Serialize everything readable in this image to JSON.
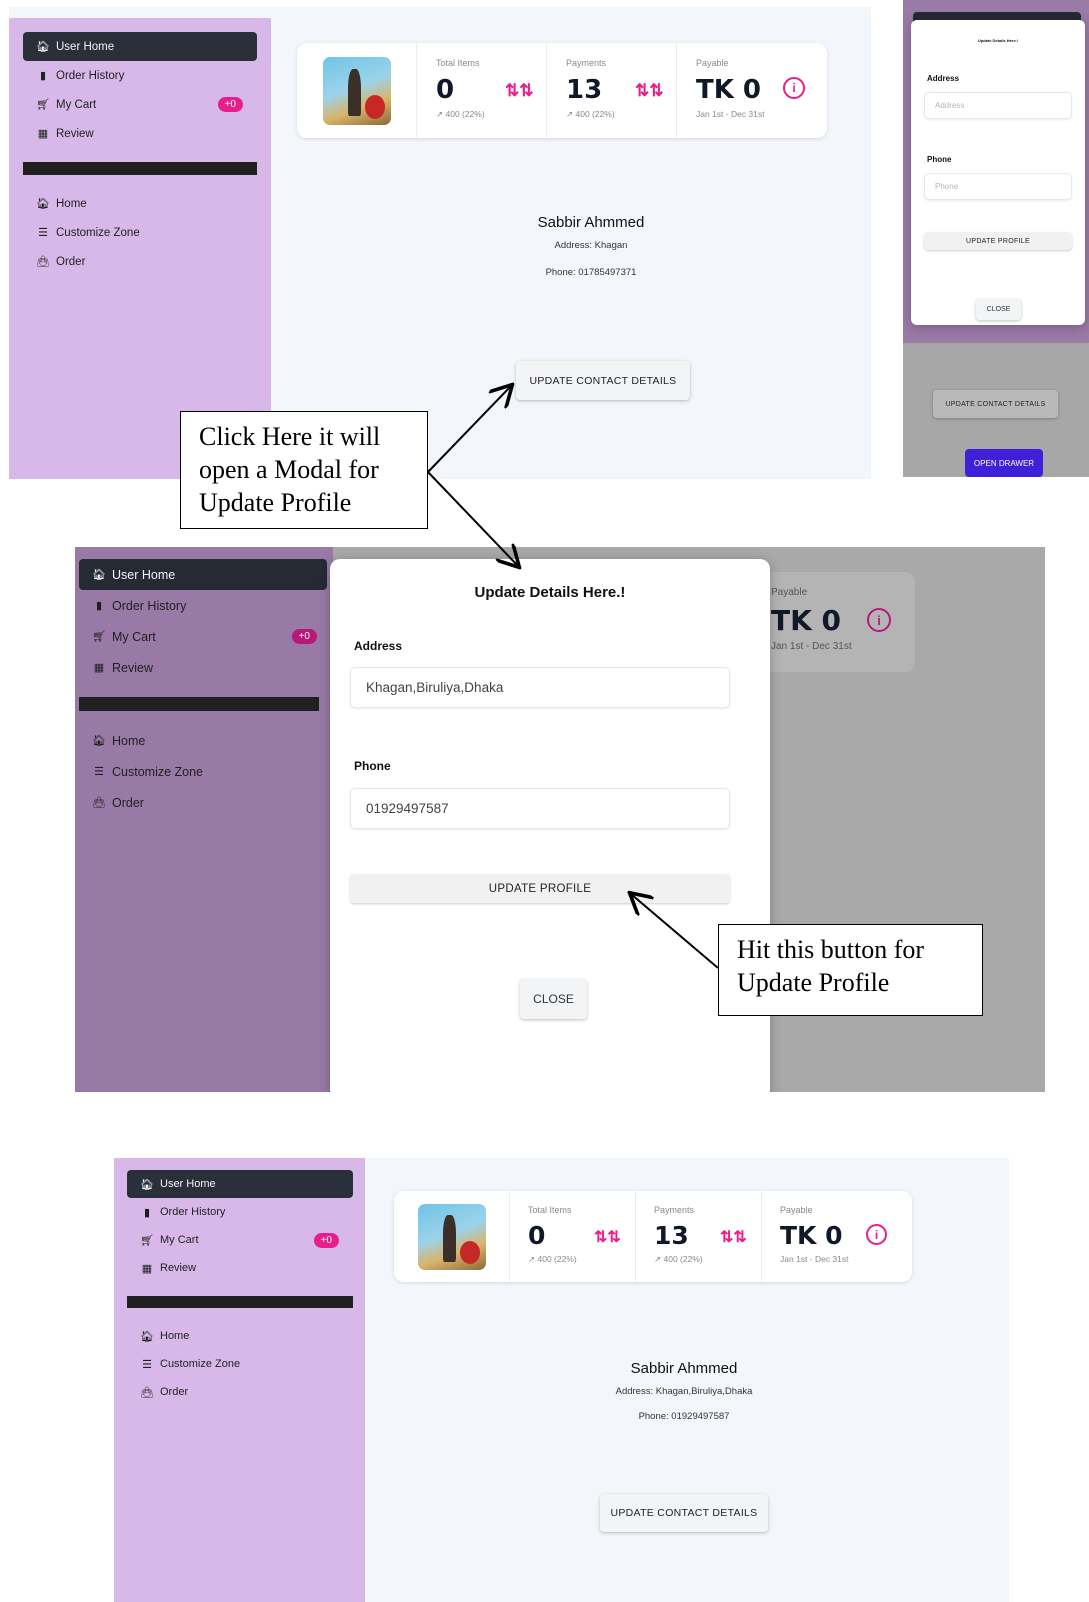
{
  "sidebar": {
    "items": [
      {
        "label": "User Home",
        "icon": "home-icon"
      },
      {
        "label": "Order History",
        "icon": "wallet-icon"
      },
      {
        "label": "My Cart",
        "icon": "cart-icon",
        "badge": "+0"
      },
      {
        "label": "Review",
        "icon": "calendar-icon"
      }
    ],
    "links": [
      {
        "label": "Home",
        "icon": "home-icon"
      },
      {
        "label": "Customize Zone",
        "icon": "bars-icon"
      },
      {
        "label": "Order",
        "icon": "bag-icon"
      }
    ]
  },
  "stats": {
    "total_items": {
      "label": "Total Items",
      "value": "0",
      "sub": "↗ 400 (22%)"
    },
    "payments": {
      "label": "Payments",
      "value": "13",
      "sub": "↗ 400 (22%)"
    },
    "payable": {
      "label": "Payable",
      "value": "TK 0",
      "sub": "Jan 1st - Dec 31st"
    }
  },
  "profile_before": {
    "name": "Sabbir Ahmmed",
    "address": "Address: Khagan",
    "phone": "Phone: 01785497371"
  },
  "profile_after": {
    "name": "Sabbir Ahmmed",
    "address": "Address: Khagan,Biruliya,Dhaka",
    "phone": "Phone: 01929497587"
  },
  "buttons": {
    "update_contact": "UPDATE CONTACT DETAILS",
    "update_profile": "UPDATE PROFILE",
    "close": "CLOSE",
    "open_drawer": "OPEN DRAWER"
  },
  "modal": {
    "title": "Update Details Here.!",
    "address_label": "Address",
    "address_value": "Khagan,Biruliya,Dhaka",
    "address_placeholder": "Address",
    "phone_label": "Phone",
    "phone_value": "01929497587",
    "phone_placeholder": "Phone"
  },
  "annotations": {
    "click_here": [
      "Click Here it will",
      "open a Modal for",
      "Update Profile"
    ],
    "hit_button": [
      "Hit this button for",
      "Update Profile"
    ]
  },
  "colors": {
    "sidebar": "#d8b8e8",
    "active_item": "#2b2f3a",
    "accent_pink": "#e91e8c",
    "drawer_button": "#3f1fd8"
  }
}
